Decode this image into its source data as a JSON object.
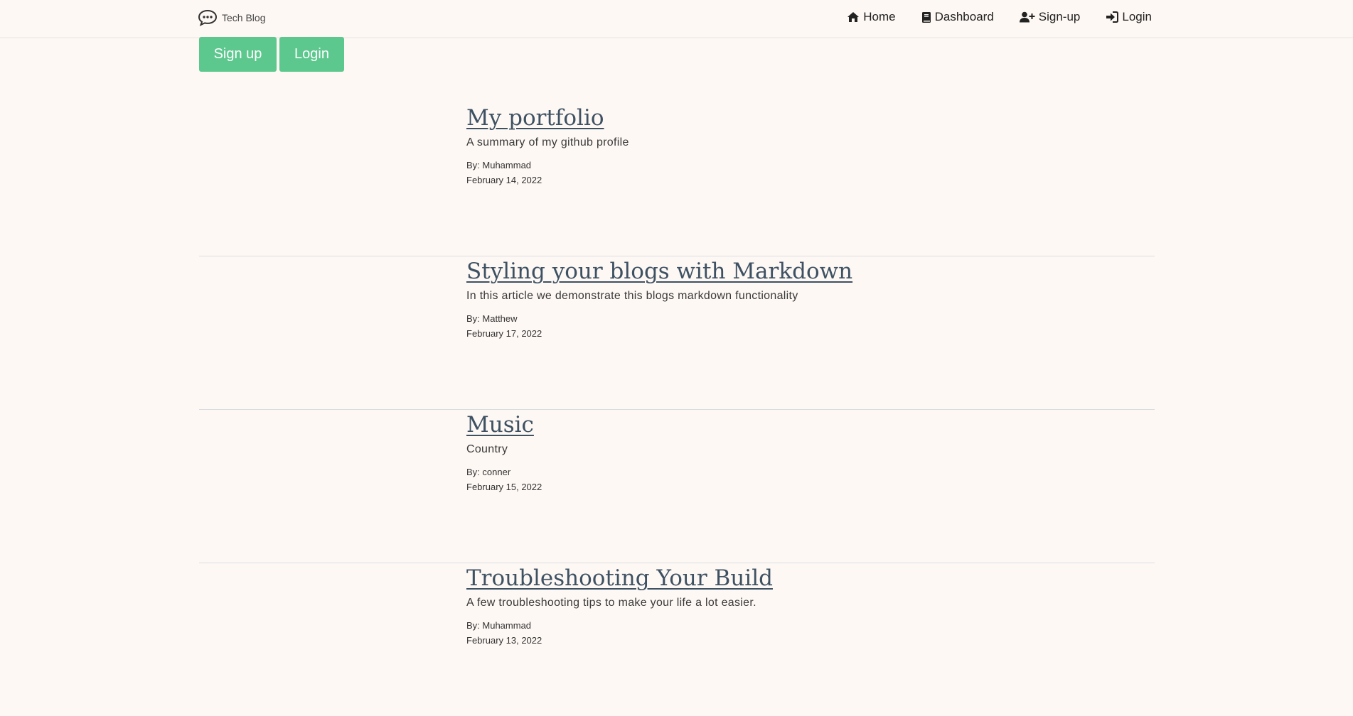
{
  "nav": {
    "brand": "Tech Blog",
    "links": [
      {
        "label": "Home",
        "icon": "home-icon"
      },
      {
        "label": "Dashboard",
        "icon": "book-icon"
      },
      {
        "label": "Sign-up",
        "icon": "user-plus-icon"
      },
      {
        "label": "Login",
        "icon": "sign-in-icon"
      }
    ]
  },
  "actions": {
    "signup_label": "Sign up",
    "login_label": "Login",
    "button_color": "#5dc88e"
  },
  "posts": [
    {
      "title": "My portfolio",
      "summary": "A summary of my github profile",
      "author": "By: Muhammad",
      "date": "February 14, 2022"
    },
    {
      "title": "Styling your blogs with Markdown",
      "summary": "In this article we demonstrate this blogs markdown functionality",
      "author": "By: Matthew",
      "date": "February 17, 2022"
    },
    {
      "title": "Music",
      "summary": "Country",
      "author": "By: conner",
      "date": "February 15, 2022"
    },
    {
      "title": "Troubleshooting Your Build",
      "summary": "A few troubleshooting tips to make your life a lot easier.",
      "author": "By: Muhammad",
      "date": "February 13, 2022"
    }
  ]
}
